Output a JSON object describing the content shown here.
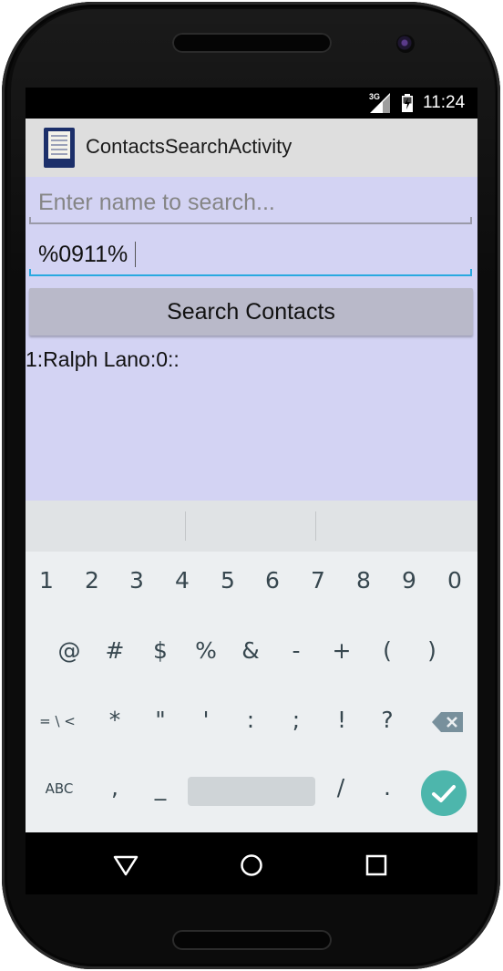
{
  "status_bar": {
    "network_label": "3G",
    "time": "11:24"
  },
  "action_bar": {
    "app_icon": "contacts-sheet-icon",
    "title": "ContactsSearchActivity"
  },
  "form": {
    "name_placeholder": "Enter name to search...",
    "name_value": "",
    "number_value": "%0911%",
    "search_button_label": "Search Contacts",
    "result_text": "1:Ralph Lano:0::"
  },
  "keyboard": {
    "row1": [
      "1",
      "2",
      "3",
      "4",
      "5",
      "6",
      "7",
      "8",
      "9",
      "0"
    ],
    "row2": [
      "@",
      "#",
      "$",
      "%",
      "&",
      "-",
      "+",
      "(",
      ")"
    ],
    "row3_switch": "= \\ <",
    "row3": [
      "*",
      "\"",
      "'",
      ":",
      ";",
      "!",
      "?"
    ],
    "row4_abc": "ABC",
    "row4_comma": ",",
    "row4_underscore": "_",
    "row4_slash": "/",
    "row4_period": ".",
    "backspace_icon": "backspace-icon",
    "enter_icon": "checkmark-icon"
  },
  "nav_bar": {
    "back_icon": "back-triangle-icon",
    "home_icon": "home-circle-icon",
    "recents_icon": "recents-square-icon"
  },
  "colors": {
    "content_bg": "#d3d3f3",
    "action_bar_bg": "#dedede",
    "accent_underline": "#29a9e0",
    "button_bg": "#b9b9c9",
    "keyboard_bg": "#eceff1",
    "enter_key_bg": "#4db6ac"
  }
}
